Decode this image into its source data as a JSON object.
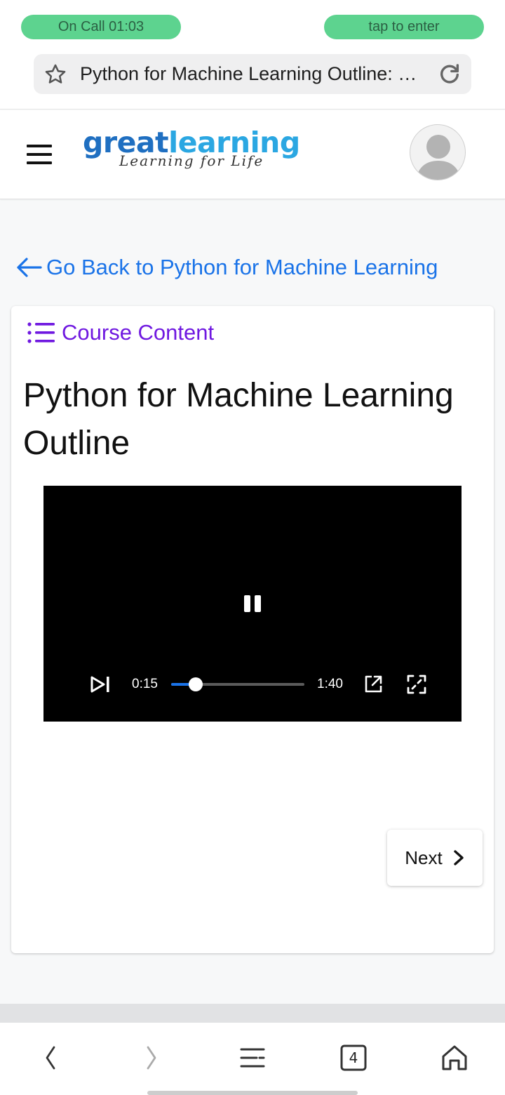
{
  "call_banner": {
    "left_label": "On Call   01:03",
    "right_label": "tap to enter"
  },
  "browser": {
    "page_title": "Python for Machine Learning Outline: …",
    "open_tab_count": "4"
  },
  "site": {
    "logo": {
      "great": "great",
      "learning": "learning",
      "tagline": "Learning for Life"
    }
  },
  "nav": {
    "back_link": "Go Back to Python for Machine Learning"
  },
  "lesson": {
    "course_content_label": "Course Content",
    "title": "Python for Machine Learning Outline",
    "next_label": "Next"
  },
  "video": {
    "current_time": "0:15",
    "duration": "1:40",
    "progress_fraction": 0.15,
    "state": "playing"
  },
  "colors": {
    "accent_link": "#1a73e8",
    "course_purple": "#6f18e0",
    "call_green": "#5dd38f",
    "logo_dark_blue": "#1f6fc1",
    "logo_light_blue": "#2ba7e2"
  },
  "icons": [
    "star-icon",
    "reload-icon",
    "hamburger-menu-icon",
    "avatar-icon",
    "back-arrow-icon",
    "list-icon",
    "pause-icon",
    "skip-next-icon",
    "popout-icon",
    "fullscreen-icon",
    "chevron-right-icon",
    "browser-back-icon",
    "browser-forward-icon",
    "browser-menu-icon",
    "tabs-icon",
    "home-icon"
  ]
}
